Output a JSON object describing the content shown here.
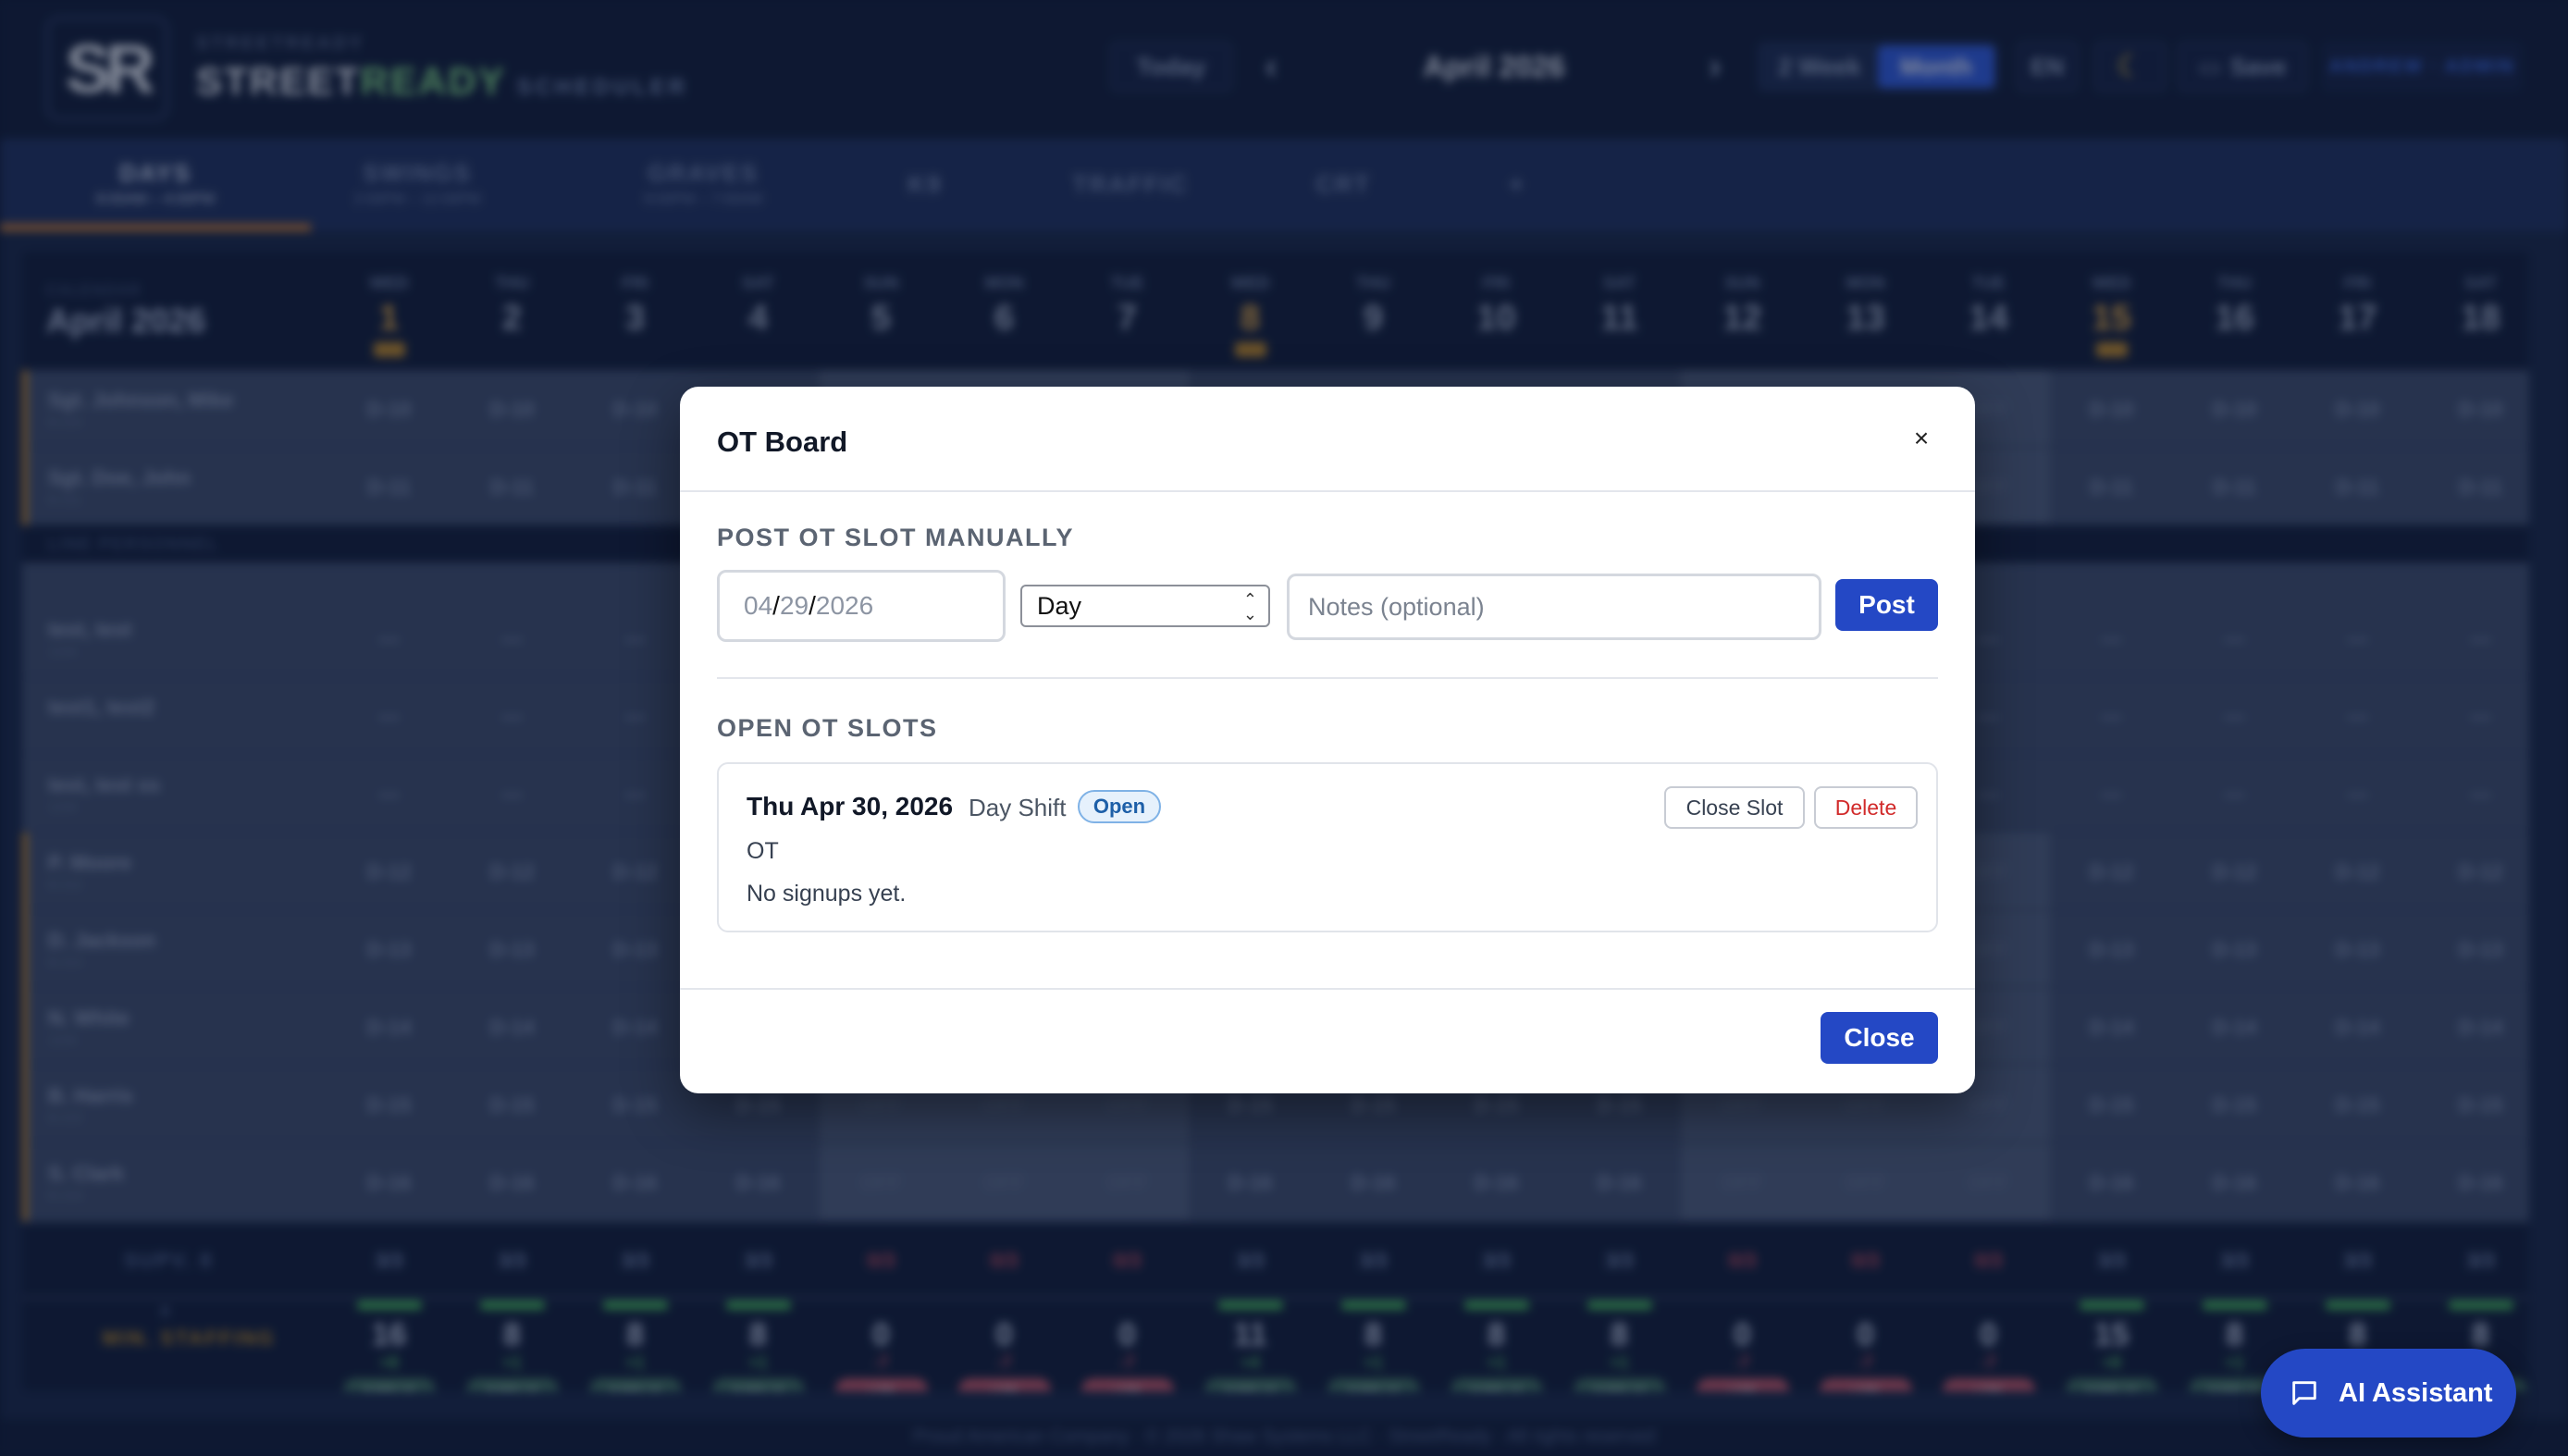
{
  "app": {
    "brand_small": "STREETREADY",
    "brand_street": "STREET",
    "brand_ready": "READY",
    "brand_sub": "SCHEDULER",
    "logo_text": "SR"
  },
  "topbar": {
    "today": "Today",
    "prev": "‹",
    "next": "›",
    "month": "April 2026",
    "view_week": "2 Week",
    "view_month": "Month",
    "lang": "EN",
    "save": "Save",
    "user": "ANDREW · ADMIN"
  },
  "tabs": [
    {
      "label": "DAYS",
      "sub": "8:00AM – 4:00PM"
    },
    {
      "label": "SWINGS",
      "sub": "2:00PM – 12:00PM"
    },
    {
      "label": "GRAVES",
      "sub": "9:00PM – 7:00AM"
    },
    {
      "label": "K9",
      "sub": ""
    },
    {
      "label": "TRAFFIC",
      "sub": ""
    },
    {
      "label": "CRT",
      "sub": ""
    },
    {
      "label": "+",
      "sub": ""
    }
  ],
  "calendar": {
    "label": "CALENDAR",
    "month": "April 2026",
    "days": [
      {
        "dow": "WED",
        "num": "1"
      },
      {
        "dow": "THU",
        "num": "2"
      },
      {
        "dow": "FRI",
        "num": "3"
      },
      {
        "dow": "SAT",
        "num": "4"
      },
      {
        "dow": "SUN",
        "num": "5"
      },
      {
        "dow": "MON",
        "num": "6"
      },
      {
        "dow": "TUE",
        "num": "7"
      },
      {
        "dow": "WED",
        "num": "8"
      },
      {
        "dow": "THU",
        "num": "9"
      },
      {
        "dow": "FRI",
        "num": "10"
      },
      {
        "dow": "SAT",
        "num": "11"
      },
      {
        "dow": "SUN",
        "num": "12"
      },
      {
        "dow": "MON",
        "num": "13"
      },
      {
        "dow": "TUE",
        "num": "14"
      },
      {
        "dow": "WED",
        "num": "15"
      },
      {
        "dow": "THU",
        "num": "16"
      },
      {
        "dow": "FRI",
        "num": "17"
      },
      {
        "dow": "SAT",
        "num": "18"
      }
    ],
    "section_line": "LINE PERSONNEL",
    "rows": [
      {
        "name": "Sgt. Johnson, Mike",
        "sub": "B-210",
        "code": "D-10"
      },
      {
        "name": "Sgt. Doe, John",
        "sub": "B-211",
        "code": "D-11"
      },
      {
        "name": "test, test",
        "sub": "1234",
        "code": "—"
      },
      {
        "name": "test1, test2",
        "sub": "",
        "code": "—"
      },
      {
        "name": "test, test ss",
        "sub": "1234",
        "code": "—"
      },
      {
        "name": "P. Moore",
        "sub": "B-212",
        "code": "D-12"
      },
      {
        "name": "D. Jackson",
        "sub": "B-213",
        "code": "D-13"
      },
      {
        "name": "N. White",
        "sub": "1234",
        "code": "D-14"
      },
      {
        "name": "B. Harris",
        "sub": "B-215",
        "code": "D-15"
      },
      {
        "name": "S. Clark",
        "sub": "B-216",
        "code": "D-16"
      }
    ],
    "off_label": "OFF",
    "supv_label": "SUPV. 8",
    "supv_values": [
      "3/3",
      "3/3",
      "3/3",
      "3/3",
      "0/3",
      "0/3",
      "0/3",
      "3/3",
      "3/3",
      "3/3",
      "3/3",
      "0/3",
      "0/3",
      "0/3",
      "3/3",
      "3/3",
      "3/3",
      "3/3"
    ],
    "min_label": "MIN. STAFFING",
    "min_prefix": "8",
    "staffing": [
      {
        "n": "16",
        "d": "+8",
        "s": "SURPLUS"
      },
      {
        "n": "8",
        "d": "+1",
        "s": "SURPLUS"
      },
      {
        "n": "8",
        "d": "+1",
        "s": "SURPLUS"
      },
      {
        "n": "8",
        "d": "+1",
        "s": "SURPLUS"
      },
      {
        "n": "0",
        "d": "-7",
        "s": "LOW"
      },
      {
        "n": "0",
        "d": "-7",
        "s": "LOW"
      },
      {
        "n": "0",
        "d": "-7",
        "s": "LOW"
      },
      {
        "n": "11",
        "d": "+4",
        "s": "SURPLUS"
      },
      {
        "n": "8",
        "d": "+1",
        "s": "SURPLUS"
      },
      {
        "n": "8",
        "d": "+1",
        "s": "SURPLUS"
      },
      {
        "n": "8",
        "d": "+1",
        "s": "SURPLUS"
      },
      {
        "n": "0",
        "d": "-7",
        "s": "LOW"
      },
      {
        "n": "0",
        "d": "-7",
        "s": "LOW"
      },
      {
        "n": "0",
        "d": "-7",
        "s": "LOW"
      },
      {
        "n": "15",
        "d": "+8",
        "s": "SURPLUS"
      },
      {
        "n": "8",
        "d": "+1",
        "s": "SURPLUS"
      },
      {
        "n": "8",
        "d": "+1",
        "s": "SURPLUS"
      },
      {
        "n": "8",
        "d": "+1",
        "s": "SURPLUS"
      }
    ],
    "footer": "Proud American Company · © 2026 Shaw Systems LLC · StreetReady · All rights reserved"
  },
  "modal": {
    "title": "OT Board",
    "close_x": "×",
    "post_section": "POST OT SLOT MANUALLY",
    "date_mm": "04",
    "date_dd": "29",
    "date_yyyy": "2026",
    "date_sep": "/",
    "shift_value": "Day",
    "notes_placeholder": "Notes (optional)",
    "post_label": "Post",
    "open_section": "OPEN OT SLOTS",
    "slots": [
      {
        "date": "Thu Apr 30, 2026",
        "shift": "Day Shift",
        "status": "Open",
        "type": "OT",
        "signups": "No signups yet.",
        "close_label": "Close Slot",
        "delete_label": "Delete"
      }
    ],
    "close_label": "Close"
  },
  "ai_assistant": {
    "label": "AI Assistant"
  },
  "colors": {
    "primary": "#2448c5",
    "danger": "#d12a2a",
    "badge_blue": "#1d5fa8",
    "navy_bg": "#0f1d3f"
  }
}
